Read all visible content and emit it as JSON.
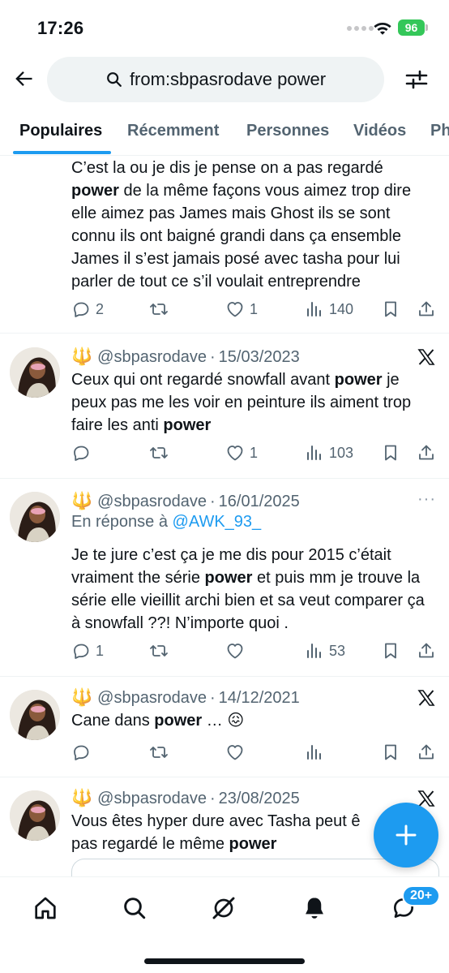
{
  "status_bar": {
    "time": "17:26",
    "battery": "96"
  },
  "search": {
    "query": "from:sbpasrodave power"
  },
  "tabs": [
    {
      "label": "Populaires",
      "active": true
    },
    {
      "label": "Récemment",
      "active": false
    },
    {
      "label": "Personnes",
      "active": false
    },
    {
      "label": "Vidéos",
      "active": false
    },
    {
      "label": "Ph",
      "active": false
    }
  ],
  "tweets": [
    {
      "text_html": "C’est la ou je dis je pense on a pas regardé <b>power</b> de la même façons vous aimez trop dire elle aimez pas James mais Ghost ils se sont connu ils ont baigné grandi dans ça ensemble James il s’est jamais posé avec tasha pour lui parler de tout ce s’il voulait entreprendre",
      "replies": "2",
      "retweets": "",
      "likes": "1",
      "views": "140"
    },
    {
      "emoji": "🔱",
      "handle": "@sbpasrodave",
      "date": "15/03/2023",
      "text_html": "Ceux qui ont regardé snowfall avant <b>power</b> je peux pas me les voir en peinture ils aiment trop faire les anti <b>power</b>",
      "replies": "",
      "retweets": "",
      "likes": "1",
      "views": "103"
    },
    {
      "emoji": "🔱",
      "handle": "@sbpasrodave",
      "date": "16/01/2025",
      "reply_prefix": "En réponse à",
      "reply_to": "@AWK_93_",
      "text_html": "Je te jure c’est ça je me dis pour 2015 c’était vraiment the série <b>power</b> et puis mm je trouve la série elle vieillit archi bien et sa veut comparer ça à snowfall ??! N’importe quoi .",
      "replies": "1",
      "retweets": "",
      "likes": "",
      "views": "53"
    },
    {
      "emoji": "🔱",
      "handle": "@sbpasrodave",
      "date": "14/12/2021",
      "text_html": "Cane dans <b>power</b> … 😖",
      "replies": "",
      "retweets": "",
      "likes": "",
      "views": ""
    },
    {
      "emoji": "🔱",
      "handle": "@sbpasrodave",
      "date": "23/08/2025",
      "text_html": "Vous êtes hyper dure avec Tasha peut ê pas regardé le même <b>power</b>",
      "replies": "",
      "retweets": "",
      "likes": "",
      "views": ""
    }
  ],
  "notifications_badge": "20+",
  "icons": {
    "back": "arrow-left-icon",
    "search": "search-icon",
    "filter": "filter-sliders-icon",
    "x_logo": "x-logo-icon",
    "more": "more-dots-icon",
    "reply": "reply-icon",
    "retweet": "retweet-icon",
    "like": "heart-icon",
    "views": "views-icon",
    "bookmark": "bookmark-icon",
    "share": "share-icon",
    "compose": "plus-icon",
    "home": "home-icon",
    "explore": "search-icon",
    "grok": "grok-icon",
    "notifications": "bell-icon",
    "messages": "messages-icon"
  },
  "colors": {
    "accent": "#1d9bf0",
    "text": "#0f1419",
    "muted": "#536471",
    "battery": "#34c759"
  }
}
